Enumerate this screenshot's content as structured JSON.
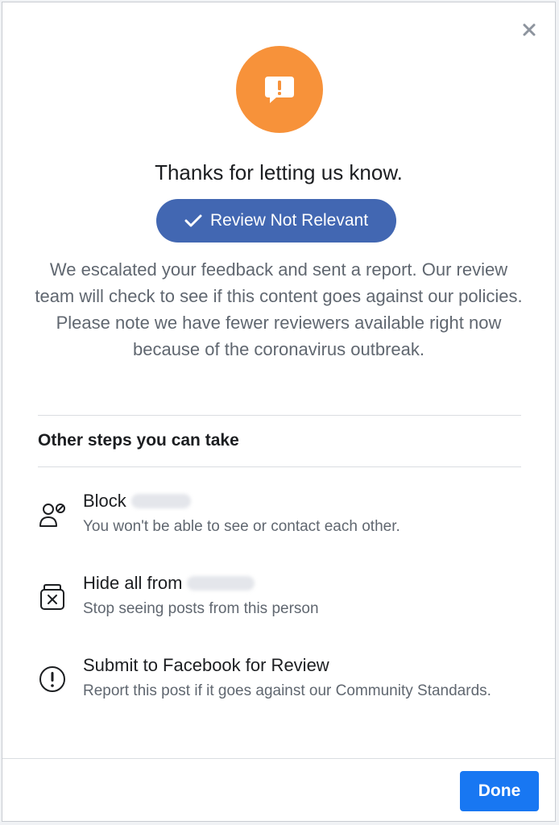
{
  "dialog": {
    "title": "Thanks for letting us know.",
    "status_pill": "Review Not Relevant",
    "description": "We escalated your feedback and sent a report. Our review team will check to see if this content goes against our policies. Please note we have fewer reviewers available right now because of the coronavirus outbreak.",
    "section_title": "Other steps you can take",
    "options": [
      {
        "title": "Block",
        "subtitle": "You won't be able to see or contact each other.",
        "icon": "block-user-icon"
      },
      {
        "title": "Hide all from",
        "subtitle": "Stop seeing posts from this person",
        "icon": "hide-box-icon"
      },
      {
        "title": "Submit to Facebook for Review",
        "subtitle": "Report this post if it goes against our Community Standards.",
        "icon": "alert-circle-icon"
      }
    ],
    "done_label": "Done"
  },
  "colors": {
    "accent_orange": "#f7923a",
    "pill_blue": "#4267b2",
    "button_blue": "#1877f2",
    "text_primary": "#1c1e21",
    "text_secondary": "#606770",
    "divider": "#dadde1"
  }
}
